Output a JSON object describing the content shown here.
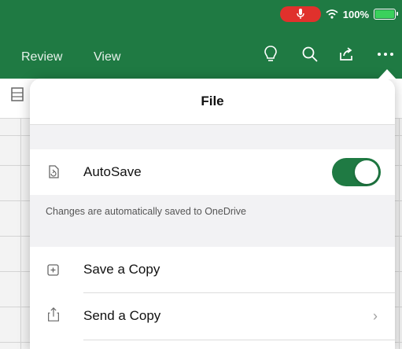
{
  "status_bar": {
    "battery_text": "100%"
  },
  "ribbon_tabs": [
    "Review",
    "View"
  ],
  "toolbar_icons": [
    "lightbulb-icon",
    "search-icon",
    "share-icon",
    "more-icon"
  ],
  "popover": {
    "title": "File",
    "autosave": {
      "label": "AutoSave",
      "enabled": true,
      "note": "Changes are automatically saved to OneDrive"
    },
    "actions": [
      {
        "label": "Save a Copy",
        "icon": "save-copy-icon",
        "has_chevron": false
      },
      {
        "label": "Send a Copy",
        "icon": "send-copy-icon",
        "has_chevron": true
      }
    ]
  },
  "colors": {
    "brand_green": "#1f7a43",
    "mic_red": "#e0312c",
    "battery_green": "#3ad15c"
  }
}
